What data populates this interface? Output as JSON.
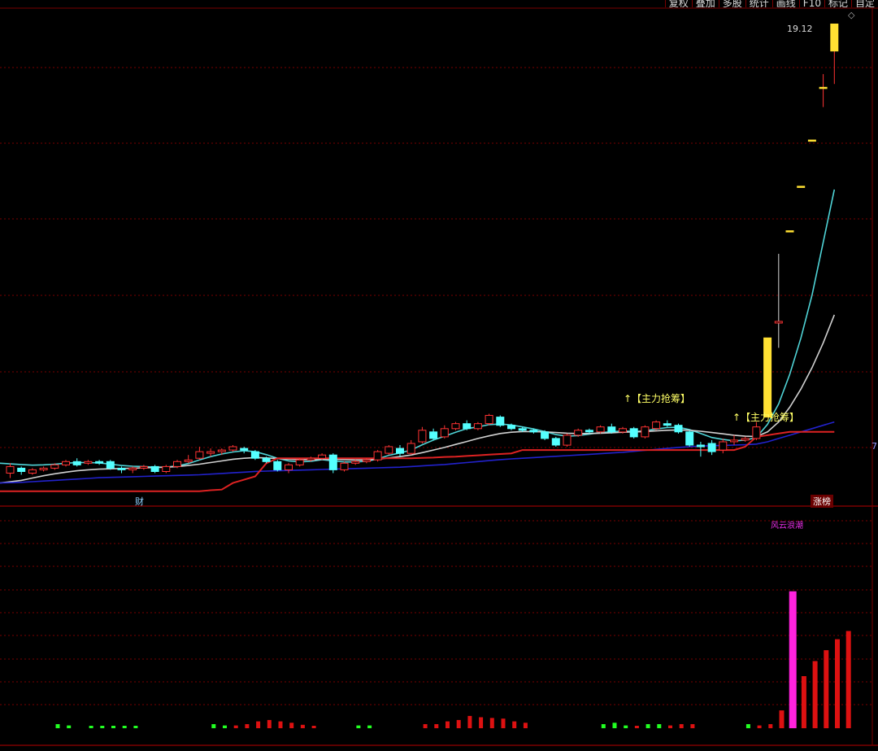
{
  "toolbar": {
    "items": [
      "复权",
      "叠加",
      "多股",
      "统计",
      "画线",
      "F10",
      "标记",
      "自定"
    ]
  },
  "labels": {
    "price_high": "19.12",
    "signal_1": "↑【主力抢筹】",
    "signal_2": "↑【主力抢筹】",
    "marker_cai": "财",
    "marker_zt": "涨榜",
    "indicator_name": "风云浪潮",
    "edge_tick": "7"
  },
  "colors": {
    "background": "#000000",
    "grid": "#7a0000",
    "up": "#ff3333",
    "down": "#54ffff",
    "limit_up": "#ffe033",
    "ma_short": "#4fd3d6",
    "ma_mid": "#d0d0d0",
    "ma_long": "#2222cc",
    "support": "#dd2222",
    "vol_peak": "#ff22dd",
    "vol_green": "#22ff22"
  },
  "chart_data": [
    {
      "type": "candlestick",
      "title": "",
      "ylim": [
        4.5,
        19.6
      ],
      "grid": true,
      "candles": [
        [
          5.5,
          5.7,
          5.35,
          5.8
        ],
        [
          5.65,
          5.55,
          5.45,
          5.7
        ],
        [
          5.5,
          5.6,
          5.45,
          5.65
        ],
        [
          5.6,
          5.65,
          5.55,
          5.7
        ],
        [
          5.65,
          5.75,
          5.6,
          5.8
        ],
        [
          5.75,
          5.85,
          5.7,
          5.9
        ],
        [
          5.85,
          5.75,
          5.7,
          5.95
        ],
        [
          5.8,
          5.85,
          5.75,
          5.9
        ],
        [
          5.85,
          5.8,
          5.75,
          5.9
        ],
        [
          5.85,
          5.65,
          5.6,
          5.9
        ],
        [
          5.65,
          5.6,
          5.5,
          5.7
        ],
        [
          5.6,
          5.65,
          5.5,
          5.7
        ],
        [
          5.65,
          5.7,
          5.6,
          5.75
        ],
        [
          5.7,
          5.55,
          5.5,
          5.75
        ],
        [
          5.55,
          5.7,
          5.5,
          5.75
        ],
        [
          5.7,
          5.85,
          5.65,
          5.9
        ],
        [
          5.85,
          5.9,
          5.8,
          6.05
        ],
        [
          5.95,
          6.15,
          5.9,
          6.3
        ],
        [
          6.1,
          6.15,
          6.0,
          6.25
        ],
        [
          6.15,
          6.2,
          6.05,
          6.25
        ],
        [
          6.2,
          6.3,
          6.15,
          6.35
        ],
        [
          6.25,
          6.2,
          6.1,
          6.3
        ],
        [
          6.15,
          5.95,
          5.9,
          6.2
        ],
        [
          5.95,
          5.85,
          5.8,
          6.0
        ],
        [
          5.85,
          5.6,
          5.55,
          5.9
        ],
        [
          5.6,
          5.75,
          5.5,
          5.8
        ],
        [
          5.75,
          5.9,
          5.7,
          5.95
        ],
        [
          5.9,
          5.95,
          5.85,
          6.0
        ],
        [
          5.95,
          6.05,
          5.9,
          6.1
        ],
        [
          6.05,
          5.6,
          5.5,
          6.1
        ],
        [
          5.6,
          5.8,
          5.55,
          5.85
        ],
        [
          5.8,
          5.85,
          5.75,
          5.9
        ],
        [
          5.85,
          5.9,
          5.8,
          5.95
        ],
        [
          5.9,
          6.15,
          5.85,
          6.2
        ],
        [
          6.1,
          6.3,
          6.05,
          6.35
        ],
        [
          6.25,
          6.1,
          6.0,
          6.35
        ],
        [
          6.1,
          6.4,
          6.05,
          6.5
        ],
        [
          6.45,
          6.8,
          6.4,
          6.9
        ],
        [
          6.75,
          6.55,
          6.5,
          6.85
        ],
        [
          6.6,
          6.85,
          6.55,
          6.95
        ],
        [
          6.85,
          7.0,
          6.8,
          7.05
        ],
        [
          7.0,
          6.85,
          6.8,
          7.1
        ],
        [
          6.85,
          7.0,
          6.8,
          7.05
        ],
        [
          7.0,
          7.25,
          6.95,
          7.3
        ],
        [
          7.2,
          6.95,
          6.9,
          7.25
        ],
        [
          6.95,
          6.85,
          6.8,
          7.0
        ],
        [
          6.85,
          6.8,
          6.75,
          6.9
        ],
        [
          6.8,
          6.75,
          6.7,
          6.85
        ],
        [
          6.75,
          6.55,
          6.5,
          6.8
        ],
        [
          6.55,
          6.35,
          6.3,
          6.6
        ],
        [
          6.35,
          6.65,
          6.3,
          6.7
        ],
        [
          6.65,
          6.8,
          6.6,
          6.85
        ],
        [
          6.8,
          6.75,
          6.7,
          6.85
        ],
        [
          6.75,
          6.9,
          6.7,
          6.95
        ],
        [
          6.9,
          6.75,
          6.7,
          7.0
        ],
        [
          6.75,
          6.85,
          6.7,
          6.9
        ],
        [
          6.85,
          6.6,
          6.55,
          6.9
        ],
        [
          6.6,
          6.9,
          6.55,
          6.95
        ],
        [
          6.85,
          7.05,
          6.8,
          7.1
        ],
        [
          7.0,
          6.95,
          6.9,
          7.1
        ],
        [
          6.95,
          6.75,
          6.7,
          7.0
        ],
        [
          6.75,
          6.35,
          6.3,
          6.8
        ],
        [
          6.35,
          6.3,
          6.0,
          6.45
        ],
        [
          6.4,
          6.15,
          6.05,
          6.5
        ],
        [
          6.2,
          6.45,
          6.1,
          6.55
        ],
        [
          6.45,
          6.5,
          6.35,
          6.65
        ],
        [
          6.5,
          6.55,
          6.45,
          6.6
        ],
        [
          6.55,
          6.9,
          6.5,
          7.05
        ],
        [
          7.2,
          9.6,
          7.2,
          9.6
        ],
        [
          10.05,
          10.1,
          9.3,
          12.15
        ],
        [
          12.85,
          12.85,
          12.85,
          12.85
        ],
        [
          14.2,
          14.2,
          14.2,
          14.2
        ],
        [
          15.6,
          15.6,
          15.6,
          15.6
        ],
        [
          17.2,
          17.2,
          16.6,
          17.6
        ],
        [
          18.3,
          19.12,
          17.3,
          19.12
        ]
      ],
      "series": [
        {
          "name": "",
          "color": "#4fd3d6",
          "values": [
            5.8,
            5.76,
            5.74,
            5.75,
            5.77,
            5.8,
            5.82,
            5.82,
            5.81,
            5.77,
            5.73,
            5.71,
            5.7,
            5.68,
            5.68,
            5.72,
            5.79,
            5.9,
            6.0,
            6.08,
            6.14,
            6.18,
            6.15,
            6.06,
            5.95,
            5.87,
            5.84,
            5.86,
            5.91,
            5.87,
            5.84,
            5.84,
            5.86,
            5.93,
            6.04,
            6.11,
            6.2,
            6.36,
            6.5,
            6.62,
            6.74,
            6.85,
            6.9,
            6.97,
            6.99,
            6.96,
            6.9,
            6.84,
            6.76,
            6.67,
            6.62,
            6.64,
            6.68,
            6.73,
            6.75,
            6.78,
            6.76,
            6.78,
            6.84,
            6.88,
            6.89,
            6.82,
            6.7,
            6.58,
            6.52,
            6.48,
            6.5,
            6.58,
            6.98,
            7.6,
            8.5,
            9.6,
            10.9,
            12.5,
            14.1
          ]
        },
        {
          "name": "",
          "color": "#d0d0d0",
          "values": [
            5.2,
            5.28,
            5.35,
            5.42,
            5.48,
            5.53,
            5.57,
            5.6,
            5.62,
            5.63,
            5.64,
            5.65,
            5.66,
            5.67,
            5.68,
            5.7,
            5.73,
            5.77,
            5.82,
            5.87,
            5.92,
            5.95,
            5.97,
            5.96,
            5.94,
            5.92,
            5.91,
            5.91,
            5.92,
            5.92,
            5.91,
            5.9,
            5.9,
            5.92,
            5.96,
            6.0,
            6.05,
            6.12,
            6.2,
            6.28,
            6.37,
            6.46,
            6.55,
            6.63,
            6.7,
            6.74,
            6.76,
            6.76,
            6.75,
            6.73,
            6.71,
            6.7,
            6.7,
            6.71,
            6.72,
            6.74,
            6.75,
            6.76,
            6.78,
            6.8,
            6.81,
            6.8,
            6.77,
            6.73,
            6.69,
            6.65,
            6.62,
            6.61,
            6.75,
            7.05,
            7.5,
            8.05,
            8.7,
            9.45,
            10.3
          ]
        },
        {
          "name": "",
          "color": "#2222cc",
          "values": [
            5.2,
            5.22,
            5.24,
            5.26,
            5.28,
            5.3,
            5.32,
            5.34,
            5.36,
            5.37,
            5.38,
            5.39,
            5.4,
            5.41,
            5.42,
            5.43,
            5.44,
            5.45,
            5.47,
            5.49,
            5.51,
            5.53,
            5.55,
            5.56,
            5.57,
            5.58,
            5.59,
            5.6,
            5.61,
            5.62,
            5.63,
            5.64,
            5.65,
            5.66,
            5.67,
            5.68,
            5.7,
            5.72,
            5.74,
            5.76,
            5.79,
            5.82,
            5.85,
            5.88,
            5.91,
            5.93,
            5.95,
            5.97,
            5.99,
            6.01,
            6.03,
            6.05,
            6.07,
            6.09,
            6.11,
            6.13,
            6.16,
            6.19,
            6.22,
            6.25,
            6.28,
            6.3,
            6.32,
            6.33,
            6.34,
            6.35,
            6.36,
            6.38,
            6.45,
            6.55,
            6.65,
            6.75,
            6.85,
            6.95,
            7.05
          ]
        },
        {
          "name": "",
          "color": "#dd2222",
          "values": [
            4.95,
            4.95,
            4.95,
            4.95,
            4.95,
            4.95,
            4.95,
            4.95,
            4.95,
            4.95,
            4.95,
            4.95,
            4.95,
            4.95,
            4.95,
            4.95,
            4.95,
            4.95,
            4.98,
            5.0,
            5.2,
            5.3,
            5.4,
            5.8,
            5.95,
            5.95,
            5.95,
            5.95,
            5.95,
            5.95,
            5.95,
            5.95,
            5.95,
            5.95,
            5.95,
            5.95,
            5.95,
            5.96,
            5.97,
            5.99,
            6.0,
            6.02,
            6.04,
            6.06,
            6.08,
            6.1,
            6.2,
            6.2,
            6.2,
            6.2,
            6.2,
            6.2,
            6.2,
            6.2,
            6.2,
            6.2,
            6.2,
            6.2,
            6.2,
            6.2,
            6.2,
            6.2,
            6.2,
            6.2,
            6.2,
            6.2,
            6.3,
            6.6,
            6.65,
            6.7,
            6.75,
            6.75,
            6.75,
            6.75,
            6.75
          ]
        }
      ]
    },
    {
      "type": "bar",
      "title": "",
      "ylim": [
        0,
        10
      ],
      "grid": true,
      "values": [
        0.3,
        0.2,
        0,
        0.1,
        0.05,
        0.05,
        0.1,
        0.1,
        0,
        0,
        0,
        0,
        0,
        0,
        0.3,
        0.2,
        0.2,
        0.3,
        0.5,
        0.6,
        0.5,
        0.4,
        0.25,
        0.1,
        0,
        0,
        0,
        0.2,
        0.2,
        0,
        0,
        0,
        0,
        0.3,
        0.3,
        0.5,
        0.6,
        0.9,
        0.8,
        0.75,
        0.7,
        0.5,
        0.4,
        0,
        0,
        0,
        0,
        0,
        0,
        0.3,
        0.4,
        0.2,
        0.1,
        0.3,
        0.3,
        0.2,
        0.3,
        0.3,
        0,
        0,
        0,
        0,
        0.3,
        0.2,
        0.3,
        1.3,
        10.0,
        3.8,
        4.9,
        5.7,
        6.5,
        7.1
      ],
      "colors": [
        "green",
        "green",
        "none",
        "green",
        "green",
        "green",
        "green",
        "green",
        "none",
        "none",
        "none",
        "none",
        "none",
        "none",
        "green",
        "green",
        "red",
        "red",
        "red",
        "red",
        "red",
        "red",
        "red",
        "red",
        "none",
        "none",
        "none",
        "green",
        "green",
        "none",
        "none",
        "none",
        "none",
        "red",
        "red",
        "red",
        "red",
        "red",
        "red",
        "red",
        "red",
        "red",
        "red",
        "none",
        "none",
        "none",
        "none",
        "none",
        "none",
        "green",
        "green",
        "green",
        "red",
        "green",
        "green",
        "red",
        "red",
        "red",
        "none",
        "none",
        "none",
        "none",
        "green",
        "red",
        "red",
        "red",
        "magenta",
        "red",
        "red",
        "red",
        "red",
        "red"
      ]
    }
  ]
}
